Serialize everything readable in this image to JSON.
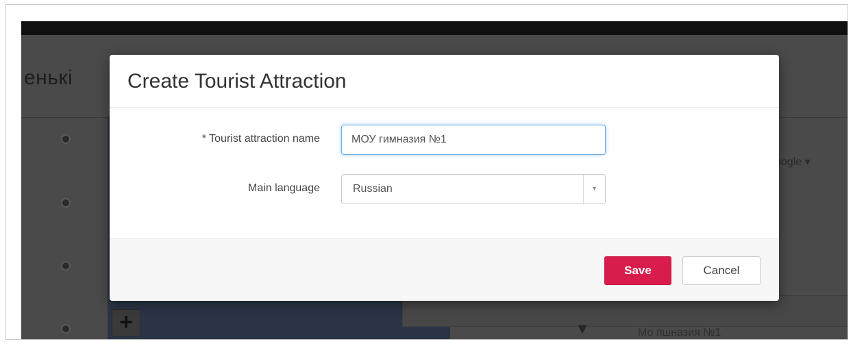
{
  "background": {
    "page_title_fragment": "енькі",
    "dropdown_label": "oogle",
    "bottom_text": "Мо пшназия №1"
  },
  "modal": {
    "title": "Create Tourist Attraction",
    "fields": {
      "name_label": "* Tourist attraction name",
      "name_value": "МОУ гимназия №1",
      "language_label": "Main language",
      "language_value": "Russian"
    },
    "buttons": {
      "save": "Save",
      "cancel": "Cancel"
    }
  },
  "colors": {
    "save_button": "#d81d4c",
    "input_focus": "#66afe9"
  }
}
